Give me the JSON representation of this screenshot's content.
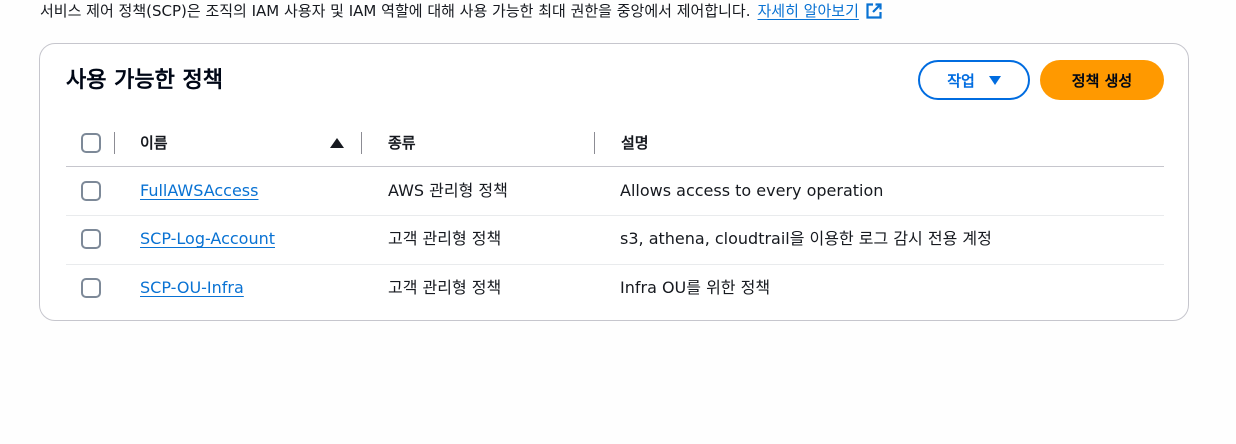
{
  "description": {
    "text": "서비스 제어 정책(SCP)은 조직의 IAM 사용자 및 IAM 역할에 대해 사용 가능한 최대 권한을 중앙에서 제어합니다.",
    "learn_more": "자세히 알아보기"
  },
  "panel": {
    "title": "사용 가능한 정책",
    "actions_label": "작업",
    "create_label": "정책 생성"
  },
  "table": {
    "columns": [
      "이름",
      "종류",
      "설명"
    ],
    "sort": {
      "column": "이름",
      "direction": "ascending"
    },
    "rows": [
      {
        "name": "FullAWSAccess",
        "type": "AWS 관리형 정책",
        "description": "Allows access to every operation"
      },
      {
        "name": "SCP-Log-Account",
        "type": "고객 관리형 정책",
        "description": "s3, athena, cloudtrail을 이용한 로그 감시 전용 계정"
      },
      {
        "name": "SCP-OU-Infra",
        "type": "고객 관리형 정책",
        "description": "Infra OU를 위한 정책"
      }
    ]
  },
  "icons": {
    "external_link": "external-link-icon",
    "dropdown": "caret-down-icon",
    "sort": "sort-ascending-icon"
  },
  "colors": {
    "link": "#0972d3",
    "primary_button": "#ff9900",
    "secondary_button_border": "#006ce0",
    "text": "#16191f"
  }
}
